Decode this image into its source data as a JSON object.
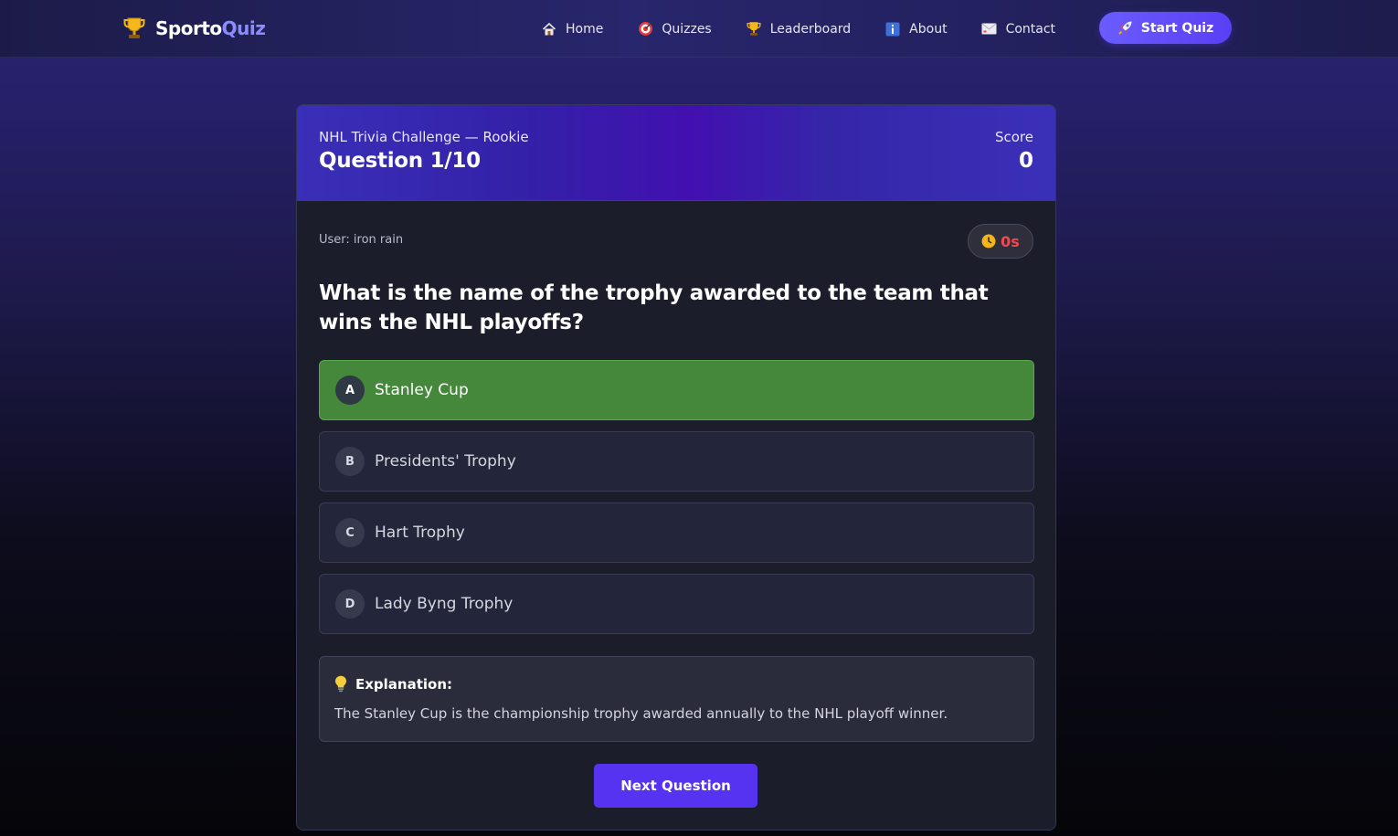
{
  "navbar": {
    "brand_part1": "Sporto",
    "brand_part2": "Quiz",
    "brand_icon": "trophy-icon",
    "links": [
      {
        "label": "Home",
        "icon": "house-icon"
      },
      {
        "label": "Quizzes",
        "icon": "target-icon"
      },
      {
        "label": "Leaderboard",
        "icon": "trophy-icon"
      },
      {
        "label": "About",
        "icon": "info-icon"
      },
      {
        "label": "Contact",
        "icon": "envelope-icon"
      }
    ],
    "cta_label": "Start Quiz",
    "cta_icon": "rocket-icon"
  },
  "quiz": {
    "title": "NHL Trivia Challenge — Rookie",
    "question_label": "Question 1/10",
    "score_label": "Score",
    "score_value": "0",
    "user_label": "User: iron rain",
    "timer_value": "0s",
    "timer_icon": "clock-icon",
    "question": "What is the name of the trophy awarded to the team that wins the NHL playoffs?",
    "options": [
      {
        "letter": "A",
        "text": "Stanley Cup",
        "state": "correct"
      },
      {
        "letter": "B",
        "text": "Presidents' Trophy",
        "state": "default"
      },
      {
        "letter": "C",
        "text": "Hart Trophy",
        "state": "default"
      },
      {
        "letter": "D",
        "text": "Lady Byng Trophy",
        "state": "default"
      }
    ],
    "explanation_title": "Explanation:",
    "explanation_icon": "lightbulb-icon",
    "explanation_text": "The Stanley Cup is the championship trophy awarded annually to the NHL playoff winner.",
    "next_label": "Next Question"
  },
  "colors": {
    "accent": "#5533f0",
    "brand_highlight": "#8b8cff",
    "correct": "#46883b",
    "timer": "#ef4a52"
  }
}
